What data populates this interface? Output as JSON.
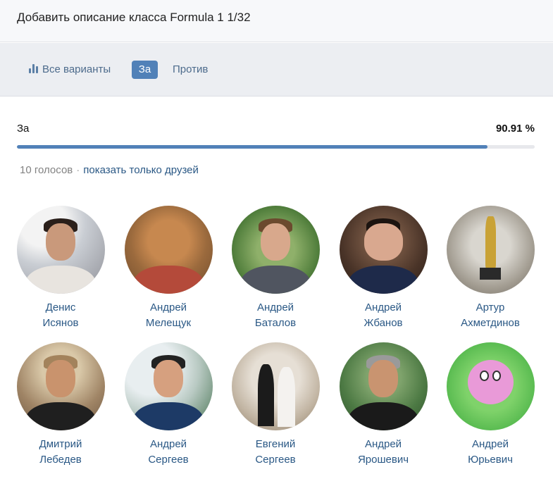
{
  "header": {
    "title": "Добавить описание класса Formula 1 1/32"
  },
  "tabs": [
    {
      "label": "Все варианты",
      "icon": "bar-chart-icon"
    },
    {
      "label": "За",
      "active": true
    },
    {
      "label": "Против"
    }
  ],
  "accent_color": "#5181b8",
  "option": {
    "label": "За",
    "percent_text": "90.91 %",
    "percent_value": 90.91
  },
  "votes": {
    "count_text": "10 голосов",
    "separator": "·",
    "friends_link": "показать только друзей"
  },
  "voters": [
    {
      "first": "Денис",
      "last": "Исянов"
    },
    {
      "first": "Андрей",
      "last": "Мелещук"
    },
    {
      "first": "Андрей",
      "last": "Баталов"
    },
    {
      "first": "Андрей",
      "last": "Жбанов"
    },
    {
      "first": "Артур",
      "last": "Ахметдинов"
    },
    {
      "first": "Дмитрий",
      "last": "Лебедев"
    },
    {
      "first": "Андрей",
      "last": "Сергеев"
    },
    {
      "first": "Евгений",
      "last": "Сергеев"
    },
    {
      "first": "Андрей",
      "last": "Ярошевич"
    },
    {
      "first": "Андрей",
      "last": "Юрьевич"
    }
  ]
}
